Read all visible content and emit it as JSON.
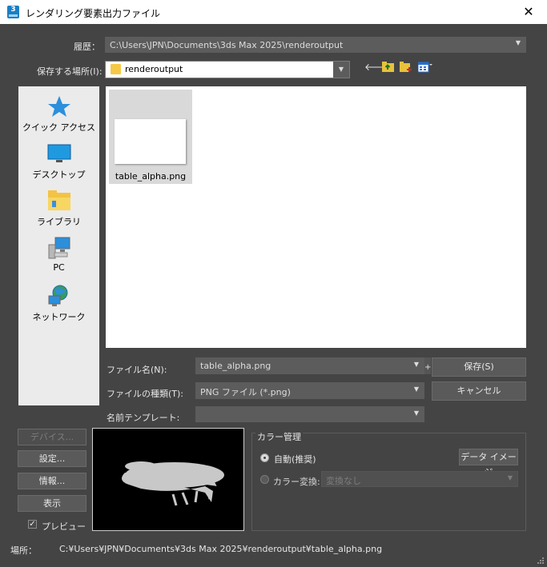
{
  "window": {
    "title": "レンダリング要素出力ファイル",
    "close_glyph": "✕",
    "app_icon_text": "3"
  },
  "history": {
    "label": "履歴：",
    "value": "C:\\Users\\JPN\\Documents\\3ds Max 2025\\renderoutput"
  },
  "save_in": {
    "label": "保存する場所(I):",
    "value": "renderoutput"
  },
  "places": [
    {
      "label": "クイック アクセス",
      "icon": "star-icon"
    },
    {
      "label": "デスクトップ",
      "icon": "desktop-icon"
    },
    {
      "label": "ライブラリ",
      "icon": "library-folder-icon"
    },
    {
      "label": "PC",
      "icon": "computer-icon"
    },
    {
      "label": "ネットワーク",
      "icon": "network-icon"
    }
  ],
  "files": [
    {
      "name": "table_alpha.png"
    }
  ],
  "filename": {
    "label": "ファイル名(N):",
    "value": "table_alpha.png",
    "plus": "+"
  },
  "filetype": {
    "label": "ファイルの種類(T):",
    "value": "PNG ファイル (*.png)"
  },
  "name_template": {
    "label": "名前テンプレート:",
    "value": ""
  },
  "buttons": {
    "save": "保存(S)",
    "cancel": "キャンセル",
    "devices": "デバイス...",
    "setup": "設定...",
    "info": "情報...",
    "view": "表示"
  },
  "preview_checkbox": {
    "label": "プレビュー",
    "checked": true
  },
  "color_management": {
    "title": "カラー管理",
    "auto_label": "自動(推奨)",
    "convert_label": "カラー変換:",
    "convert_value": "変換なし",
    "data_image": "データ イメージ"
  },
  "location": {
    "label": "場所：",
    "value": "C:¥Users¥JPN¥Documents¥3ds Max 2025¥renderoutput¥table_alpha.png"
  }
}
